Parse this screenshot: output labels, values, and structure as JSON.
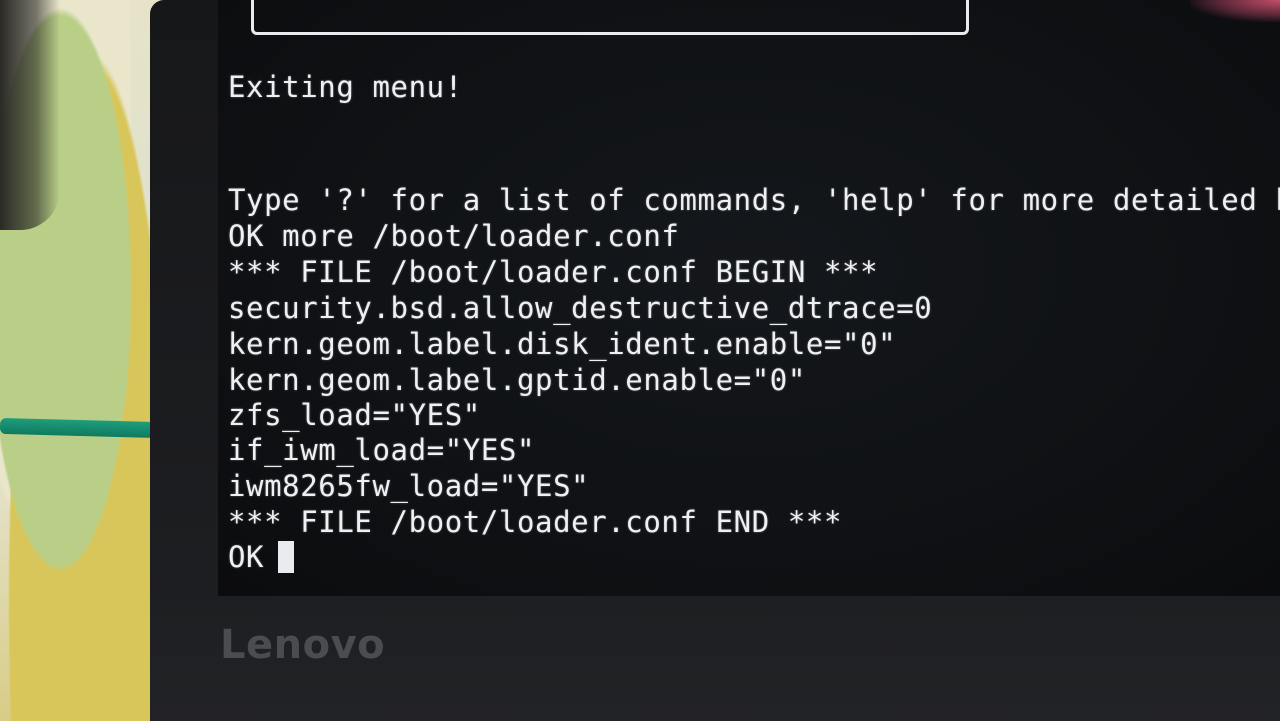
{
  "terminal": {
    "lines": [
      "Exiting menu!",
      "Type '?' for a list of commands, 'help' for more detailed h",
      "OK more /boot/loader.conf",
      "*** FILE /boot/loader.conf BEGIN ***",
      "security.bsd.allow_destructive_dtrace=0",
      "kern.geom.label.disk_ident.enable=\"0\"",
      "kern.geom.label.gptid.enable=\"0\"",
      "zfs_load=\"YES\"",
      "if_iwm_load=\"YES\"",
      "iwm8265fw_load=\"YES\"",
      "*** FILE /boot/loader.conf END ***",
      "OK"
    ]
  },
  "laptop": {
    "brand": "Lenovo"
  },
  "colors": {
    "screen_bg": "#0f1114",
    "text": "#eef0f3",
    "bezel": "#1a1b1e",
    "cable": "#1f9d7d"
  }
}
